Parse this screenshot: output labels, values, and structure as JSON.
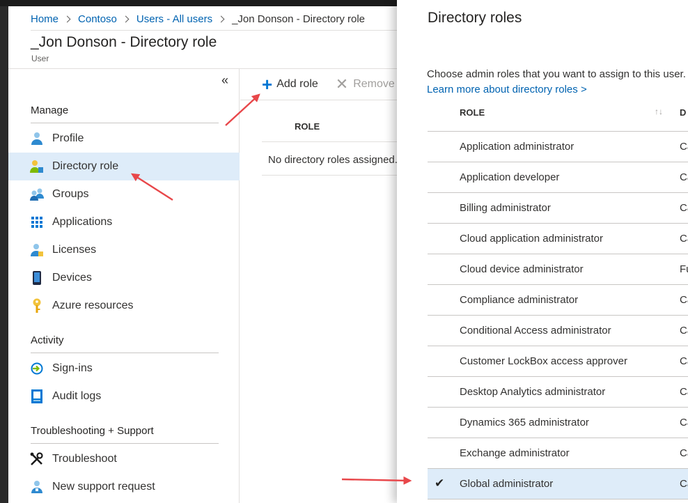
{
  "breadcrumb": {
    "items": [
      "Home",
      "Contoso",
      "Users - All users"
    ],
    "current": "_Jon Donson - Directory role"
  },
  "page": {
    "title": "_Jon Donson - Directory role",
    "subtitle": "User"
  },
  "nav": {
    "collapse_glyph": "«",
    "sections": {
      "manage": "Manage",
      "activity": "Activity",
      "troubleshooting": "Troubleshooting + Support"
    },
    "items": [
      {
        "label": "Profile",
        "icon": "user-icon"
      },
      {
        "label": "Directory role",
        "icon": "directory-role-icon",
        "selected": true
      },
      {
        "label": "Groups",
        "icon": "groups-icon"
      },
      {
        "label": "Applications",
        "icon": "applications-grid-icon"
      },
      {
        "label": "Licenses",
        "icon": "licenses-icon"
      },
      {
        "label": "Devices",
        "icon": "device-icon"
      },
      {
        "label": "Azure resources",
        "icon": "key-icon"
      },
      {
        "label": "Sign-ins",
        "icon": "sign-in-icon"
      },
      {
        "label": "Audit logs",
        "icon": "audit-log-icon"
      },
      {
        "label": "Troubleshoot",
        "icon": "wrench-icon"
      },
      {
        "label": "New support request",
        "icon": "support-person-icon"
      }
    ]
  },
  "commands": {
    "add_role": "Add role",
    "remove_role": "Remove r"
  },
  "assigned": {
    "column_role": "ROLE",
    "empty_message": "No directory roles assigned."
  },
  "blade": {
    "title": "Directory roles",
    "description": "Choose admin roles that you want to assign to this user.",
    "learn_more": "Learn more about directory roles >",
    "column_role": "ROLE",
    "column_description": "D",
    "sort_glyph": "↑↓",
    "roles": [
      {
        "name": "Application administrator",
        "desc": "Ca",
        "checked": false
      },
      {
        "name": "Application developer",
        "desc": "Ca",
        "checked": false
      },
      {
        "name": "Billing administrator",
        "desc": "Ca",
        "checked": false
      },
      {
        "name": "Cloud application administrator",
        "desc": "Ca",
        "checked": false
      },
      {
        "name": "Cloud device administrator",
        "desc": "Fu",
        "checked": false
      },
      {
        "name": "Compliance administrator",
        "desc": "Ca",
        "checked": false
      },
      {
        "name": "Conditional Access administrator",
        "desc": "Ca",
        "checked": false
      },
      {
        "name": "Customer LockBox access approver",
        "desc": "Ca",
        "checked": false
      },
      {
        "name": "Desktop Analytics administrator",
        "desc": "Ca",
        "checked": false
      },
      {
        "name": "Dynamics 365 administrator",
        "desc": "Ca",
        "checked": false
      },
      {
        "name": "Exchange administrator",
        "desc": "Ca",
        "checked": false
      },
      {
        "name": "Global administrator",
        "desc": "Ca",
        "checked": true
      }
    ]
  },
  "colors": {
    "accent": "#0078d4",
    "link": "#0063b1",
    "selected_bg": "#deecf9",
    "annotation_arrow": "#e8474a"
  }
}
